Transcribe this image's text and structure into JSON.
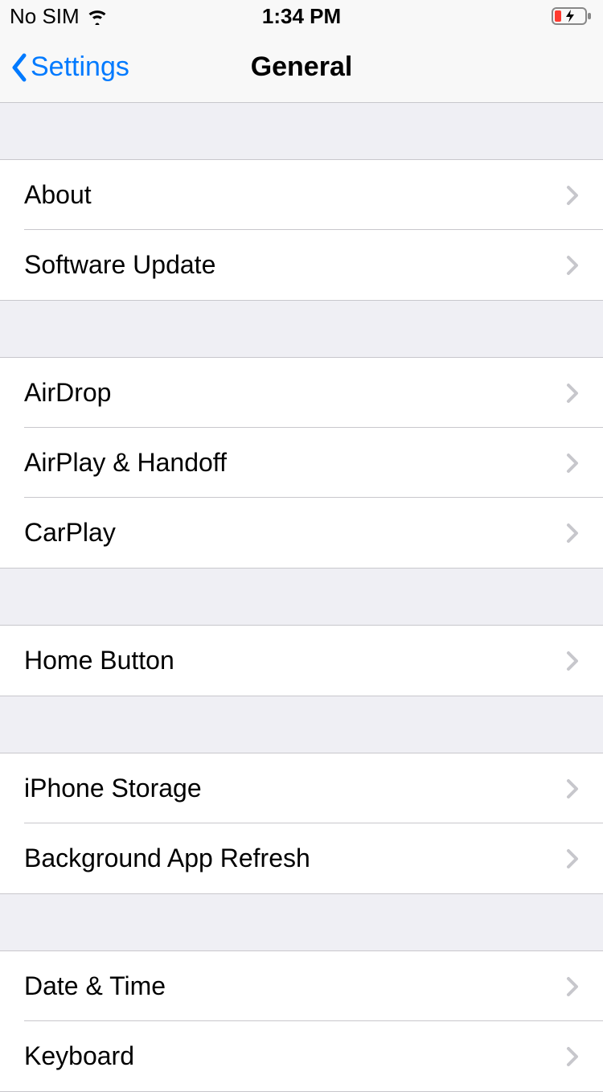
{
  "status_bar": {
    "carrier": "No SIM",
    "time": "1:34 PM"
  },
  "nav": {
    "back_label": "Settings",
    "title": "General"
  },
  "sections": [
    {
      "rows": [
        {
          "label": "About"
        },
        {
          "label": "Software Update"
        }
      ]
    },
    {
      "rows": [
        {
          "label": "AirDrop"
        },
        {
          "label": "AirPlay & Handoff"
        },
        {
          "label": "CarPlay"
        }
      ]
    },
    {
      "rows": [
        {
          "label": "Home Button"
        }
      ]
    },
    {
      "rows": [
        {
          "label": "iPhone Storage"
        },
        {
          "label": "Background App Refresh"
        }
      ]
    },
    {
      "rows": [
        {
          "label": "Date & Time"
        },
        {
          "label": "Keyboard"
        }
      ]
    }
  ]
}
